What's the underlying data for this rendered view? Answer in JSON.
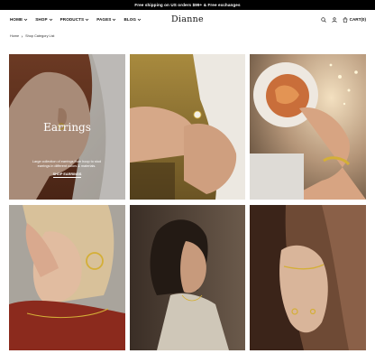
{
  "announcement": "Free shipping on US orders $99+ & Free exchanges",
  "header": {
    "nav": [
      {
        "label": "HOME",
        "has_dropdown": true
      },
      {
        "label": "SHOP",
        "has_dropdown": true
      },
      {
        "label": "PRODUCTS",
        "has_dropdown": true
      },
      {
        "label": "PAGES",
        "has_dropdown": true
      },
      {
        "label": "BLOG",
        "has_dropdown": true
      }
    ],
    "logo": "Dianne",
    "icons": [
      "search-icon",
      "account-icon",
      "cart-icon"
    ],
    "cart_label": "CART(0)"
  },
  "breadcrumb": {
    "home": "Home",
    "current": "Shop Category List"
  },
  "featured": {
    "title": "Earrings",
    "description": "Large collection of earrings from hoop to stud earrings in different colors & materials.",
    "link": "SHOP EARRINGS"
  },
  "colors": {
    "announcement_bg": "#000000",
    "text": "#111111",
    "overlay_text": "#ffffff"
  }
}
